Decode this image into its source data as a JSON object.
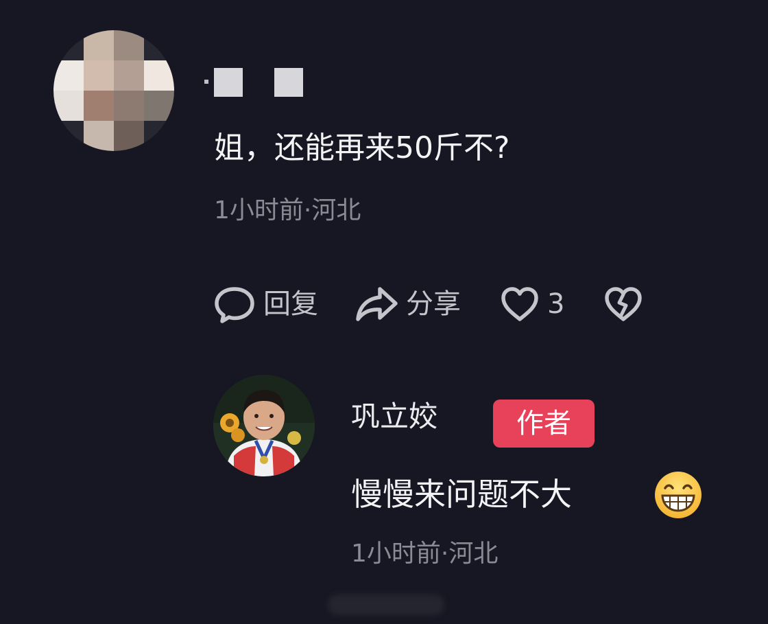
{
  "colors": {
    "background": "#161722",
    "primary_text": "#f4f4f6",
    "secondary_text": "#8b8b95",
    "action_text": "#c4c4cb",
    "author_badge": "#e8415a"
  },
  "comment": {
    "text": "姐，还能再来50斤不?",
    "meta": "1小时前·河北",
    "avatar_icon": "pixelated-avatar",
    "actions": {
      "reply_label": "回复",
      "reply_icon": "speech-bubble-icon",
      "share_label": "分享",
      "share_icon": "share-arrow-icon",
      "like_count": "3",
      "like_icon": "heart-icon",
      "dislike_icon": "broken-heart-icon"
    }
  },
  "reply": {
    "author_name": "巩立姣",
    "author_badge": "作者",
    "text": "慢慢来问题不大",
    "emoji_icon": "grinning-face-icon",
    "meta": "1小时前·河北",
    "avatar_icon": "author-avatar"
  }
}
